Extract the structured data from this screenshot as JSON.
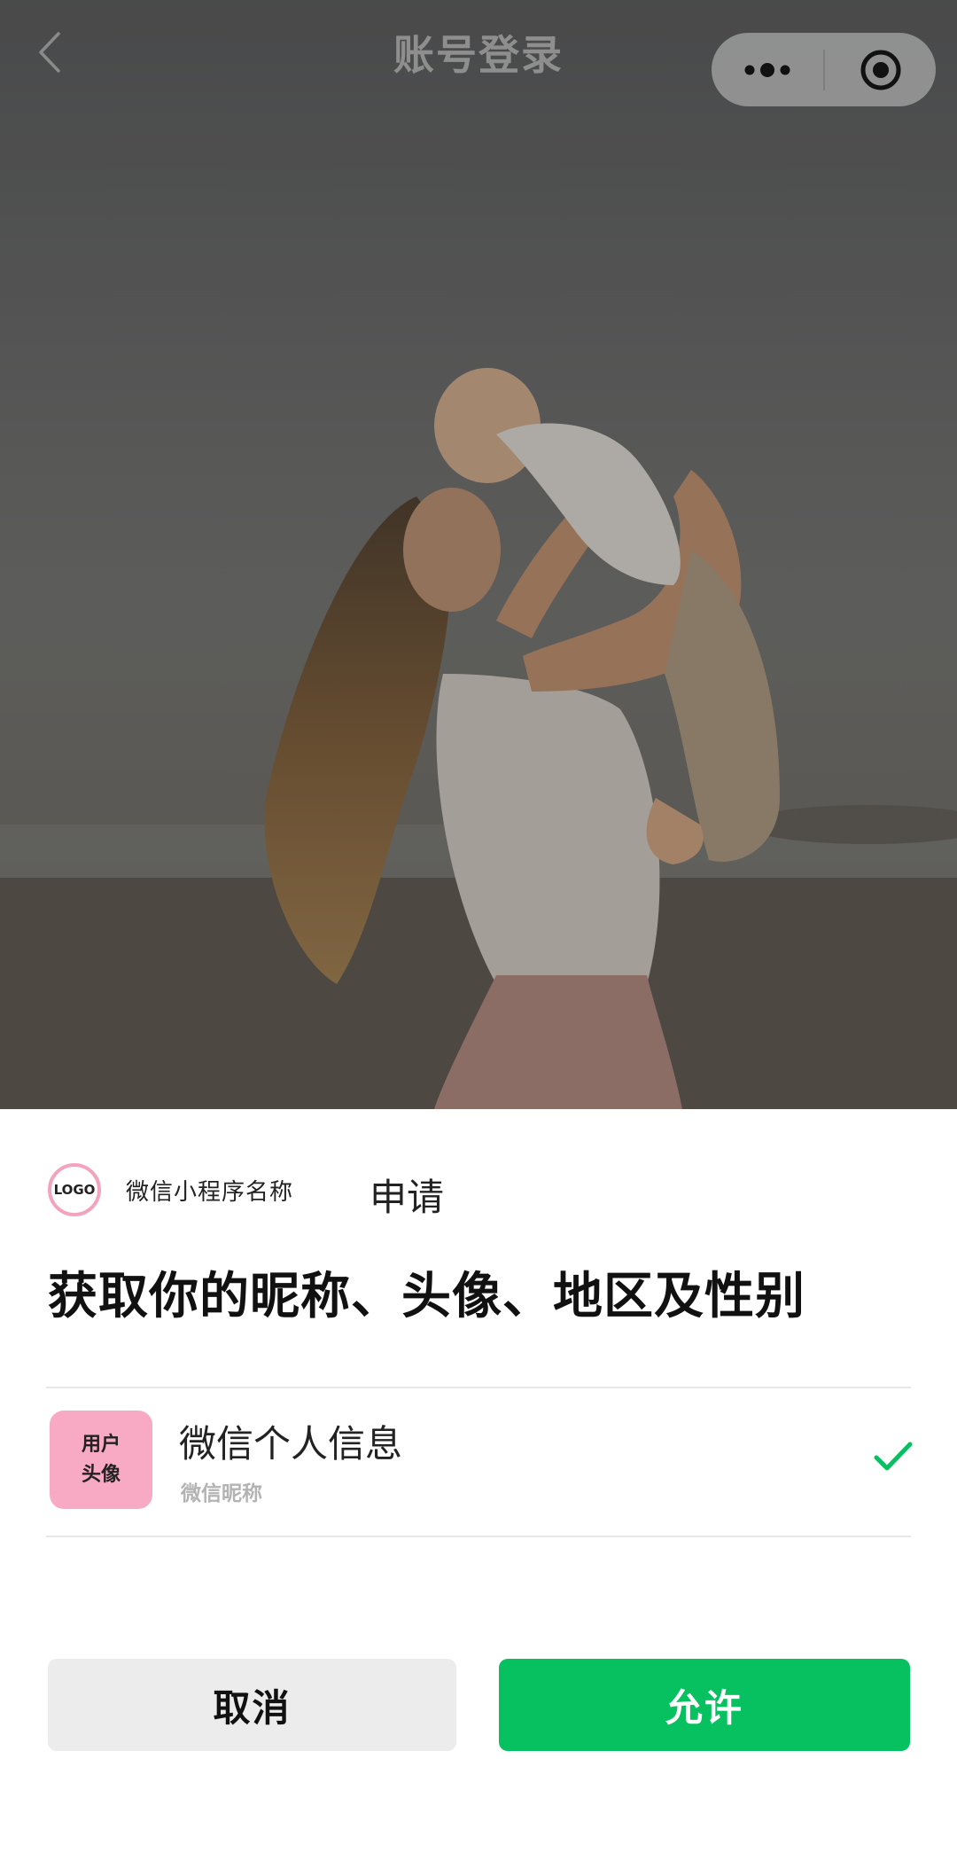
{
  "navbar": {
    "title": "账号登录",
    "back_icon": "chevron-left-icon",
    "more_icon": "more-dots-icon",
    "close_icon": "target-circle-icon"
  },
  "auth_sheet": {
    "app_logo_text": "LOGO",
    "app_name": "微信小程序名称",
    "apply_label": "申请",
    "headline": "获取你的昵称、头像、地区及性别",
    "info": {
      "avatar_line1": "用户",
      "avatar_line2": "头像",
      "title": "微信个人信息",
      "subtitle": "微信昵称",
      "selected_icon": "checkmark-icon"
    },
    "cancel_label": "取消",
    "allow_label": "允许"
  },
  "colors": {
    "accent_green": "#07c160",
    "logo_ring_pink": "#f4a3bf",
    "avatar_pink": "#f8aac4",
    "cancel_gray": "#ececec"
  }
}
